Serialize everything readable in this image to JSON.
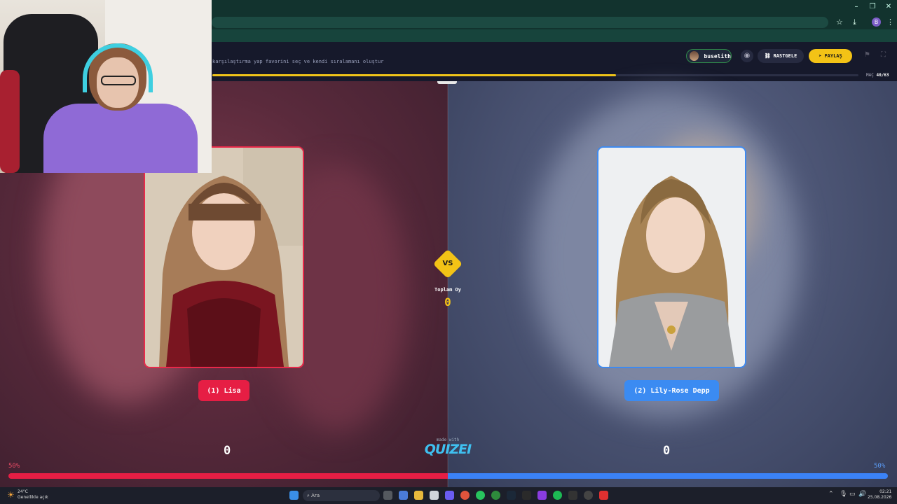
{
  "header": {
    "subtitle": "karşılaştırma yap favorini seç ve kendi sıralamanı oluştur",
    "user_name": "buselith",
    "random_label": "RASTGELE",
    "share_label": "PAYLAŞ",
    "progress": {
      "current": 40,
      "total": 63,
      "fraction": 0.625
    },
    "mac_label": "MAÇ",
    "mac_count": "40/63"
  },
  "arena": {
    "left": {
      "label": "(1) Lisa",
      "score": "0",
      "percent": "50%"
    },
    "right": {
      "label": "(2) Lily-Rose Depp",
      "score": "0",
      "percent": "50%"
    },
    "vs": "VS",
    "total_votes_label": "Toplam Oy",
    "total_votes": "0",
    "made_with": "made with",
    "brand": "QUIZEI"
  },
  "taskbar": {
    "weather_temp": "24°C",
    "weather_desc": "Genellikle açık",
    "search_label": "Ara",
    "time": "02:21",
    "date": "25.08.2026"
  },
  "colors": {
    "left_accent": "#e61e44",
    "right_accent": "#3b82f6",
    "yellow": "#f3c316"
  }
}
